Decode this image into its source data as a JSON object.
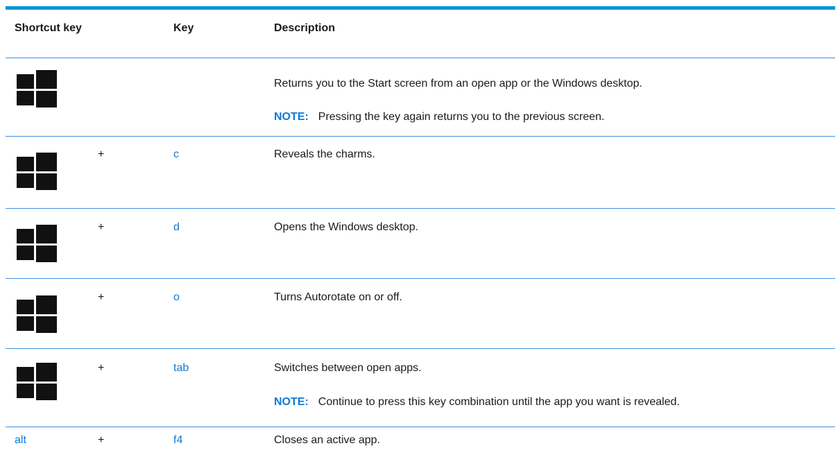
{
  "header": {
    "shortcut_key": "Shortcut key",
    "key": "Key",
    "description": "Description"
  },
  "rows": [
    {
      "icon": "windows-logo-icon",
      "plus": "",
      "key": "",
      "description": "Returns you to the Start screen from an open app or the Windows desktop.",
      "note_label": "NOTE:",
      "note_text": "Pressing the key again returns you to the previous screen."
    },
    {
      "icon": "windows-logo-icon",
      "plus": "+",
      "key": "c",
      "description": "Reveals the charms."
    },
    {
      "icon": "windows-logo-icon",
      "plus": "+",
      "key": "d",
      "description": "Opens the Windows desktop."
    },
    {
      "icon": "windows-logo-icon",
      "plus": "+",
      "key": "o",
      "description": "Turns Autorotate on or off."
    },
    {
      "icon": "windows-logo-icon",
      "plus": "+",
      "key": "tab",
      "description": "Switches between open apps.",
      "note_label": "NOTE:",
      "note_text": "Continue to press this key combination until the app you want is revealed."
    },
    {
      "shortcut_text": "alt",
      "plus": "+",
      "key": "f4",
      "description": "Closes an active app."
    }
  ],
  "colors": {
    "accent_bar": "#0096d6",
    "key_text": "#0a79d8",
    "row_rule": "#3d8ee0"
  }
}
